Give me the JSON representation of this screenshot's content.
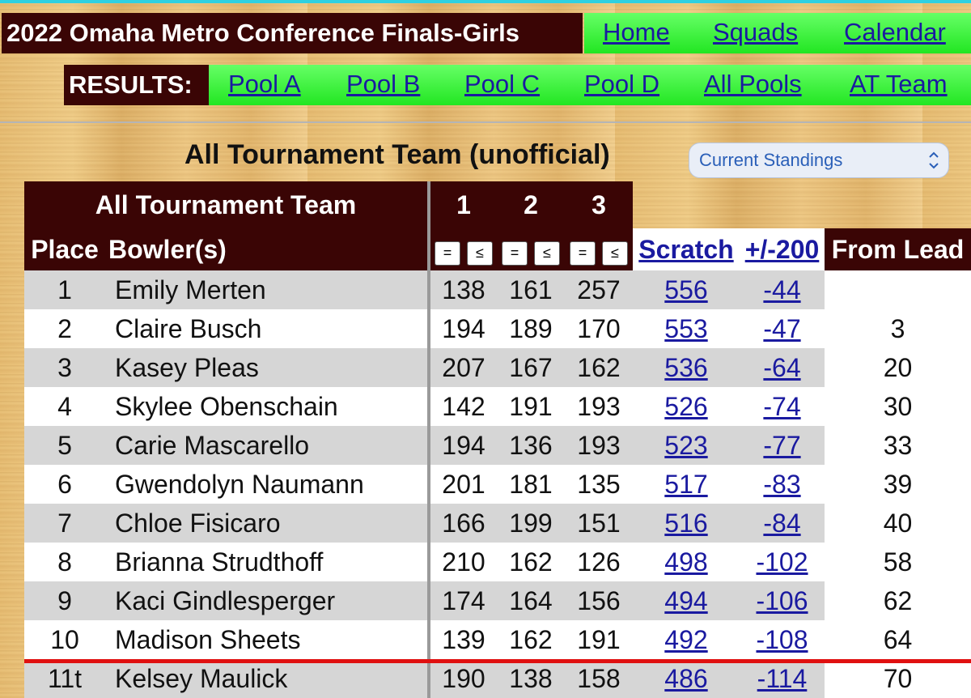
{
  "header": {
    "title": "2022 Omaha Metro Conference Finals-Girls",
    "nav": [
      "Home",
      "Squads",
      "Calendar"
    ],
    "results_label": "RESULTS:",
    "results_links": [
      "Pool A",
      "Pool B",
      "Pool C",
      "Pool D",
      "All Pools",
      "AT Team"
    ]
  },
  "page_title": "All Tournament Team (unofficial)",
  "view_select": {
    "value": "Current Standings",
    "icon": "chevron-up-down-icon"
  },
  "table": {
    "group_header": "All Tournament Team",
    "game_headers": [
      "1",
      "2",
      "3"
    ],
    "col_place": "Place",
    "col_bowler": "Bowler(s)",
    "sort_buttons": [
      "=",
      "≤",
      "=",
      "≤",
      "=",
      "≤"
    ],
    "col_scratch": "Scratch",
    "col_plusminus": "+/-200",
    "col_fromlead": "From Lead",
    "rows": [
      {
        "place": "1",
        "name": "Emily Merten",
        "g1": "138",
        "g2": "161",
        "g3": "257",
        "scratch": "556",
        "pm": "-44",
        "lead": ""
      },
      {
        "place": "2",
        "name": "Claire Busch",
        "g1": "194",
        "g2": "189",
        "g3": "170",
        "scratch": "553",
        "pm": "-47",
        "lead": "3"
      },
      {
        "place": "3",
        "name": "Kasey Pleas",
        "g1": "207",
        "g2": "167",
        "g3": "162",
        "scratch": "536",
        "pm": "-64",
        "lead": "20"
      },
      {
        "place": "4",
        "name": "Skylee Obenschain",
        "g1": "142",
        "g2": "191",
        "g3": "193",
        "scratch": "526",
        "pm": "-74",
        "lead": "30"
      },
      {
        "place": "5",
        "name": "Carie Mascarello",
        "g1": "194",
        "g2": "136",
        "g3": "193",
        "scratch": "523",
        "pm": "-77",
        "lead": "33"
      },
      {
        "place": "6",
        "name": "Gwendolyn Naumann",
        "g1": "201",
        "g2": "181",
        "g3": "135",
        "scratch": "517",
        "pm": "-83",
        "lead": "39"
      },
      {
        "place": "7",
        "name": "Chloe Fisicaro",
        "g1": "166",
        "g2": "199",
        "g3": "151",
        "scratch": "516",
        "pm": "-84",
        "lead": "40"
      },
      {
        "place": "8",
        "name": "Brianna Strudthoff",
        "g1": "210",
        "g2": "162",
        "g3": "126",
        "scratch": "498",
        "pm": "-102",
        "lead": "58"
      },
      {
        "place": "9",
        "name": "Kaci Gindlesperger",
        "g1": "174",
        "g2": "164",
        "g3": "156",
        "scratch": "494",
        "pm": "-106",
        "lead": "62"
      },
      {
        "place": "10",
        "name": "Madison Sheets",
        "g1": "139",
        "g2": "162",
        "g3": "191",
        "scratch": "492",
        "pm": "-108",
        "lead": "64"
      },
      {
        "place": "11t",
        "name": "Kelsey Maulick",
        "g1": "190",
        "g2": "138",
        "g3": "158",
        "scratch": "486",
        "pm": "-114",
        "lead": "70"
      }
    ]
  }
}
